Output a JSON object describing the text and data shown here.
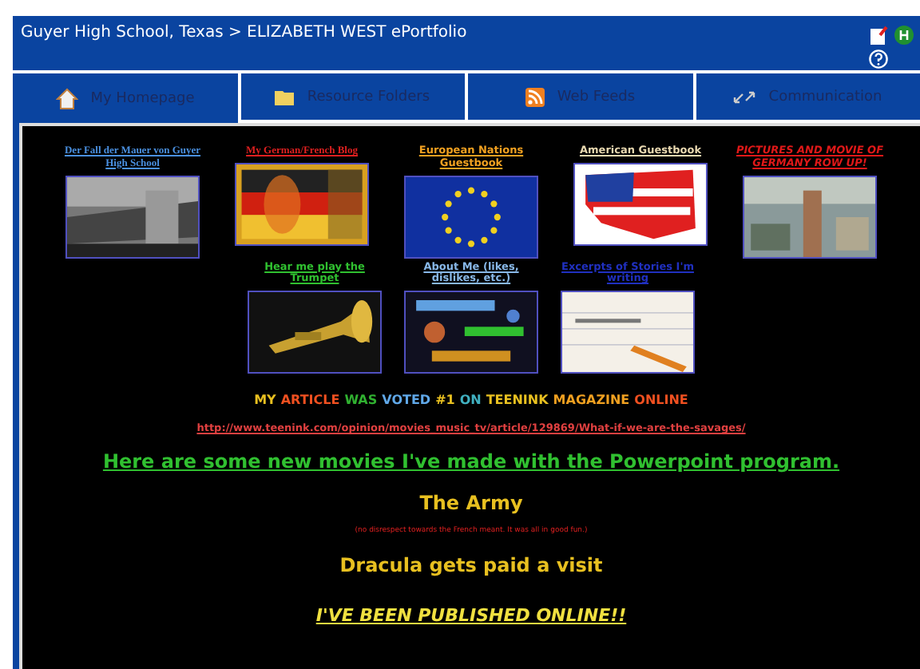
{
  "header": {
    "breadcrumb": "Guyer High School, Texas > ELIZABETH WEST ePortfolio"
  },
  "tabs": [
    {
      "label": "My Homepage",
      "selected": true
    },
    {
      "label": "Resource Folders",
      "selected": false
    },
    {
      "label": "Web Feeds",
      "selected": false
    },
    {
      "label": "Communication",
      "selected": false
    }
  ],
  "gallery_rows": [
    [
      {
        "caption": "Der Fall der Mauer von Guyer High School",
        "color": "#4a90e0"
      },
      {
        "caption": "My German/French Blog",
        "color": "#e02020"
      },
      {
        "caption": "European Nations Guestbook",
        "color": "#f0a020"
      },
      {
        "caption": "American Guestbook",
        "color": "#e8d8b0"
      },
      {
        "caption": "PICTURES AND MOVIE  OF GERMANY ROW UP!",
        "color": "#e01818"
      }
    ],
    [
      {
        "caption": "Hear me play the Trumpet",
        "color": "#30c030"
      },
      {
        "caption": "About Me (likes, dislikes, etc.)",
        "color": "#88b8e8"
      },
      {
        "caption": "Excerpts of Stories I'm writing",
        "color": "#2030c0"
      }
    ]
  ],
  "headline": [
    {
      "text": "MY",
      "color": "#e8c020"
    },
    {
      "text": "ARTICLE",
      "color": "#f05020"
    },
    {
      "text": "WAS",
      "color": "#30b030"
    },
    {
      "text": "VOTED",
      "color": "#60a8e8"
    },
    {
      "text": "#1",
      "color": "#e8c020"
    },
    {
      "text": "ON",
      "color": "#40b0c0"
    },
    {
      "text": "TEENINK",
      "color": "#e8c020"
    },
    {
      "text": "MAGAZINE",
      "color": "#f0a020"
    },
    {
      "text": "ONLINE",
      "color": "#f05020"
    }
  ],
  "article_link": "http://www.teenink.com/opinion/movies_music_tv/article/129869/What-if-we-are-the-savages/",
  "movies_link": "Here are some new movies I've made with the Powerpoint program.",
  "movies": [
    {
      "title": "The Army",
      "note": "(no disrespect towards the French meant. It was all in good fun.)"
    },
    {
      "title": "Dracula gets paid a visit"
    }
  ],
  "published_link": "I'VE BEEN PUBLISHED ONLINE!!"
}
